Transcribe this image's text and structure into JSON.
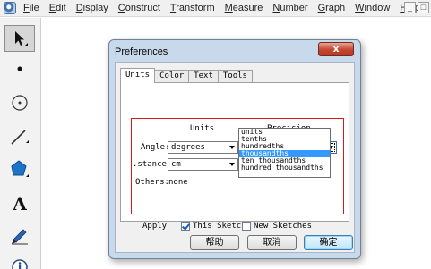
{
  "menubar": {
    "items": [
      {
        "ul": "F",
        "rest": "ile"
      },
      {
        "ul": "E",
        "rest": "dit"
      },
      {
        "ul": "D",
        "rest": "isplay"
      },
      {
        "ul": "C",
        "rest": "onstruct"
      },
      {
        "ul": "T",
        "rest": "ransform"
      },
      {
        "ul": "M",
        "rest": "easure"
      },
      {
        "ul": "N",
        "rest": "umber"
      },
      {
        "ul": "G",
        "rest": "raph"
      },
      {
        "ul": "W",
        "rest": "indow"
      },
      {
        "ul": "H",
        "rest": "elp"
      }
    ],
    "window_controls": [
      "_",
      "□"
    ]
  },
  "toolbar": {
    "tools": [
      "arrow-select-tool",
      "point-tool",
      "compass-tool",
      "straightedge-tool",
      "polygon-tool",
      "text-tool",
      "marker-tool",
      "information-tool"
    ],
    "text_tool_glyph": "A"
  },
  "dialog": {
    "title": "Preferences",
    "close_glyph": "x",
    "tabs": [
      {
        "label": "Units",
        "active": true
      },
      {
        "label": "Color",
        "active": false
      },
      {
        "label": "Text",
        "active": false
      },
      {
        "label": "Tools",
        "active": false
      }
    ],
    "col_units": "Units",
    "col_precision": "Precision",
    "angle_label": "Angle:",
    "angle_unit": "degrees",
    "angle_precision": "thousandths",
    "distance_label": ".stance:",
    "distance_unit": "cm",
    "others_label": "Others:",
    "others_value": "none",
    "precision_options": [
      "units",
      "tenths",
      "hundredths",
      "thousandths",
      "ten thousandths",
      "hundred thousandths"
    ],
    "precision_selected_index": 3,
    "apply_label": "Apply",
    "this_sketch_label": "This Sketch",
    "this_sketch_checked": true,
    "new_sketches_label": "New Sketches",
    "new_sketches_checked": false,
    "help_button": "帮助",
    "cancel_button": "取消",
    "ok_button": "确定"
  },
  "colors": {
    "highlight_box": "#d11a1a",
    "selection": "#3399ff",
    "dialog_frame": "#c8d9ec"
  }
}
